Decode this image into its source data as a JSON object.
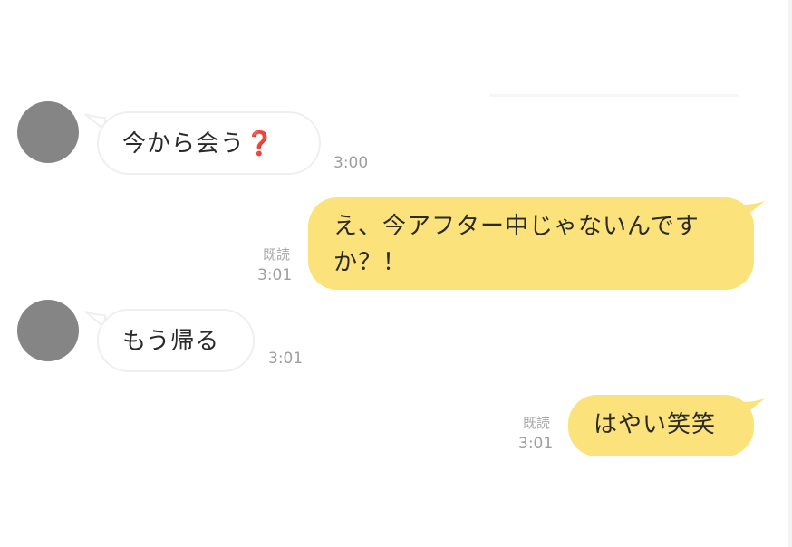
{
  "messages": [
    {
      "side": "in",
      "text": "今から会う",
      "icon": "red-question-mark-icon",
      "icon_glyph": "❓",
      "time": "3:00"
    },
    {
      "side": "out",
      "line1": "え、今アフター中じゃないんです",
      "line2": "か？！",
      "read": "既読",
      "time": "3:01"
    },
    {
      "side": "in",
      "text": "もう帰る",
      "time": "3:01"
    },
    {
      "side": "out",
      "text": "はやい笑笑",
      "read": "既読",
      "time": "3:01"
    }
  ],
  "colors": {
    "outgoing_bubble": "#fbe27a",
    "incoming_bubble": "#ffffff",
    "avatar": "#858585",
    "timestamp": "#9e9e9e"
  }
}
